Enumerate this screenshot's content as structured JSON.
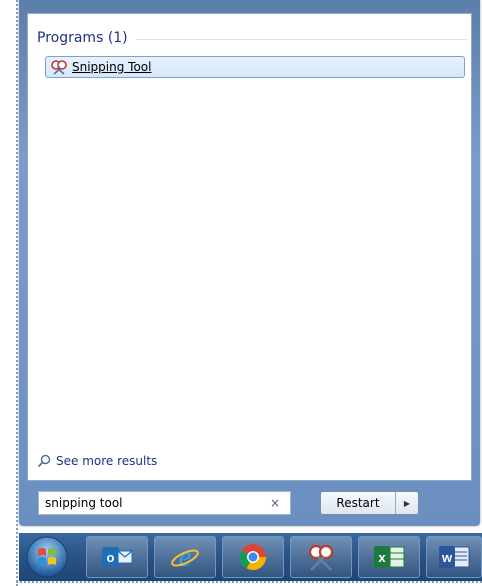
{
  "start_menu": {
    "section_title": "Programs (1)",
    "result_label": "Snipping Tool",
    "see_more_label": "See more results",
    "search_value": "snipping tool",
    "clear_glyph": "×",
    "restart_label": "Restart",
    "arrow_glyph": "▶"
  },
  "taskbar": {
    "items": [
      {
        "name": "outlook-icon"
      },
      {
        "name": "internet-explorer-icon"
      },
      {
        "name": "chrome-icon"
      },
      {
        "name": "snipping-tool-icon"
      },
      {
        "name": "excel-icon"
      },
      {
        "name": "word-icon"
      }
    ],
    "outlook_letter": "o",
    "excel_letter": "x",
    "word_letter": "w"
  },
  "colors": {
    "accent": "#1e3287",
    "selection": "#d6e7fb",
    "taskbar": "#2a5283"
  }
}
